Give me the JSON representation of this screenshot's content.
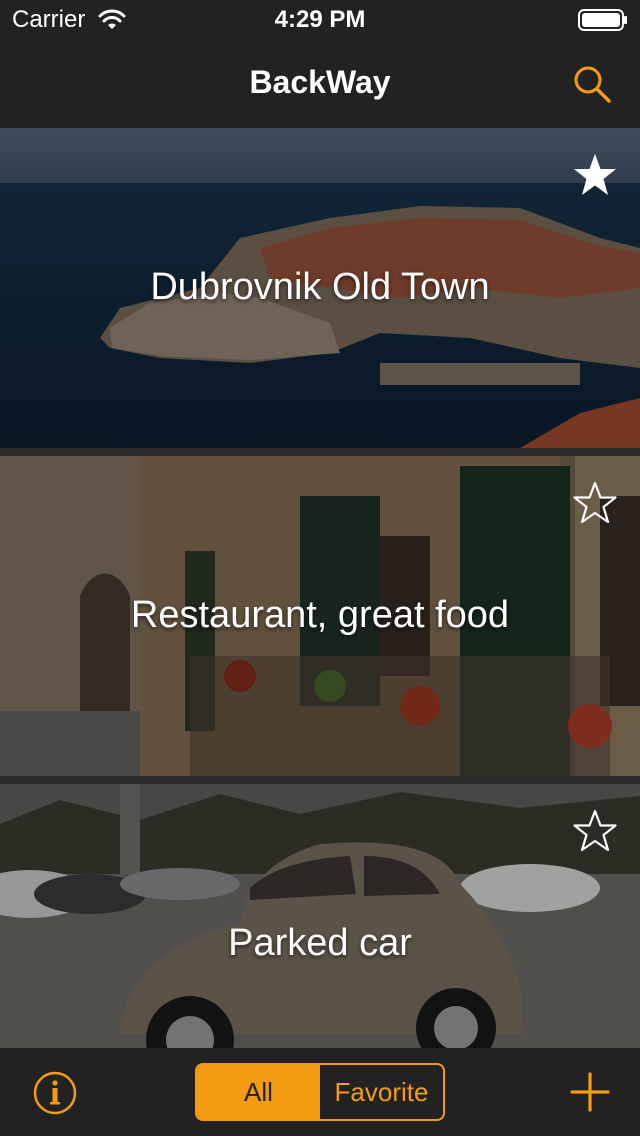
{
  "status_bar": {
    "carrier": "Carrier",
    "time": "4:29 PM"
  },
  "nav": {
    "title": "BackWay",
    "search_icon": "magnifying-glass-icon"
  },
  "items": [
    {
      "title": "Dubrovnik Old Town",
      "favorite": true,
      "photo": "coastal-old-town-photo"
    },
    {
      "title": "Restaurant, great food",
      "favorite": false,
      "photo": "street-restaurant-photo"
    },
    {
      "title": "Parked car",
      "favorite": false,
      "photo": "parked-beetle-car-photo"
    }
  ],
  "toolbar": {
    "info_icon": "info-circle-icon",
    "segments": [
      "All",
      "Favorite"
    ],
    "selected_segment": "All",
    "add_icon": "plus-icon"
  },
  "colors": {
    "accent": "#f39c12",
    "bar_background": "#222222",
    "text": "#ffffff"
  }
}
